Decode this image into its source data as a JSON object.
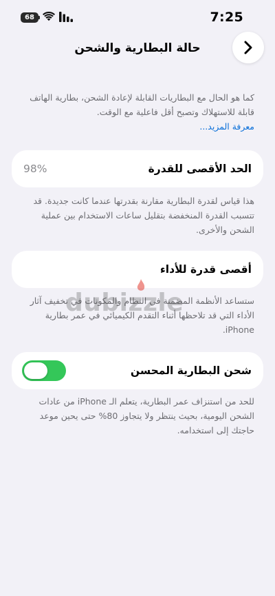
{
  "status_bar": {
    "time": "7:25",
    "battery_level": "68",
    "icons": [
      "wifi-icon",
      "cellular-signal-icon",
      "battery-icon"
    ]
  },
  "nav": {
    "title": "حالة البطارية والشحن",
    "back_icon": "chevron-right-icon"
  },
  "intro": {
    "text": "كما هو الحال مع البطاريات القابلة لإعادة الشحن، بطارية الهاتف قابلة للاستهلاك وتصبح أقل فاعلية مع الوقت.",
    "learn_more": "معرفة المزيد..."
  },
  "maximum_capacity": {
    "label": "الحد الأقصى للقدرة",
    "value": "98%",
    "description": "هذا قياس لقدرة البطارية مقارنة بقدرتها عندما كانت جديدة. قد تتسبب القدرة المنخفضة بتقليل ساعات الاستخدام بين عملية الشحن والأخرى."
  },
  "peak_performance": {
    "label": "أقصى قدرة للأداء",
    "description": "ستساعد الأنظمة المضمنة في النظام والمكونات في تخفيف آثار الأداء التي قد تلاحظها أثناء التقدم الكيميائي في عمر بطارية iPhone."
  },
  "optimized_charging": {
    "label": "شحن البطارية المحسن",
    "enabled": true,
    "description": "للحد من استنزاف عمر البطارية، يتعلم الـ iPhone من عادات الشحن اليومية، بحيث ينتظر ولا يتجاوز 80% حتى يحين موعد حاجتك إلى استخدامه."
  },
  "watermark": {
    "text": "dubizzle"
  },
  "colors": {
    "background": "#f2f1f7",
    "toggle_on": "#34c759",
    "link": "#0a6fd9",
    "secondary_text": "#6d6d72"
  }
}
